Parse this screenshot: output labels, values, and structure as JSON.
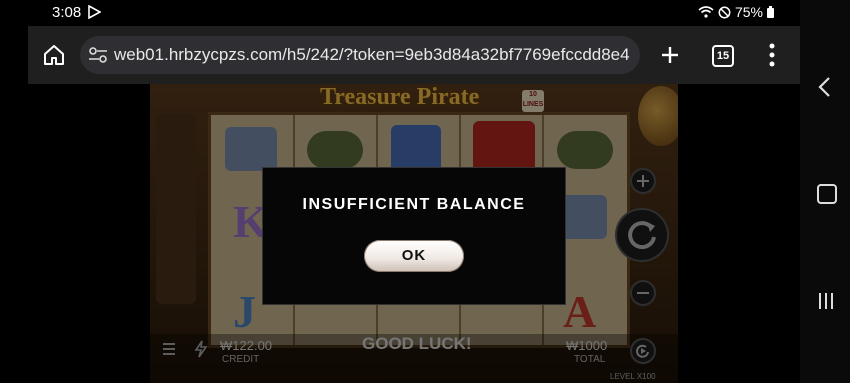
{
  "status": {
    "time": "3:08",
    "battery": "75%"
  },
  "browser": {
    "url": "web01.hrbzycpzs.com/h5/242/?token=9eb3d84a32bf7769efccdd8e4",
    "tab_count": "15"
  },
  "game": {
    "title": "Treasure Pirate",
    "lines_badge": "10 LINES",
    "reel_letters": [
      "K",
      "A",
      "J"
    ],
    "credit_value": "₩122.00",
    "credit_label": "CREDIT",
    "message": "GOOD LUCK!",
    "total_value": "₩1000",
    "total_label": "TOTAL",
    "level_text": "LEVEL  X100"
  },
  "dialog": {
    "title": "INSUFFICIENT BALANCE",
    "ok_label": "OK"
  },
  "colors": {
    "gold": "#f3c14a",
    "dialog_bg": "#060606",
    "toolbar_bg": "#1f1f1f"
  }
}
